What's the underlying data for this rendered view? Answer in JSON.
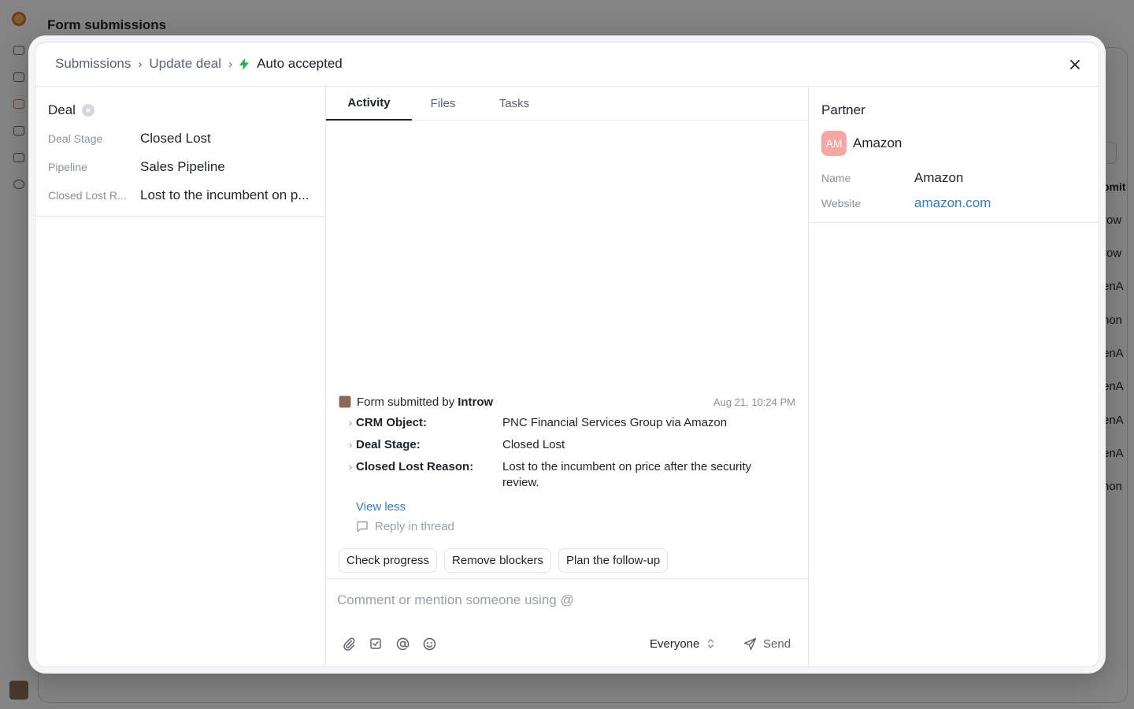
{
  "background": {
    "page_title": "Form submissions",
    "partial_column_header": "bmit",
    "partial_rows": [
      "row",
      "row",
      "enA",
      "hon",
      "enA",
      "enA",
      "enA",
      "enA",
      "hon"
    ]
  },
  "modal": {
    "breadcrumb": [
      "Submissions",
      "Update deal"
    ],
    "status": "Auto accepted",
    "status_color": "#22b24c"
  },
  "deal": {
    "title": "Deal",
    "properties": [
      {
        "label": "Deal Stage",
        "value": "Closed Lost"
      },
      {
        "label": "Pipeline",
        "value": "Sales Pipeline"
      },
      {
        "label": "Closed Lost R...",
        "value": "Lost to the incumbent on p..."
      }
    ]
  },
  "tabs": [
    {
      "label": "Activity",
      "active": true
    },
    {
      "label": "Files",
      "active": false
    },
    {
      "label": "Tasks",
      "active": false
    }
  ],
  "activity": {
    "prefix": "Form submitted by",
    "author": "Introw",
    "timestamp": "Aug 21, 10:24 PM",
    "rows": [
      {
        "key": "CRM Object:",
        "value": "PNC Financial Services Group via Amazon"
      },
      {
        "key": "Deal Stage:",
        "value": "Closed Lost"
      },
      {
        "key": "Closed Lost Reason:",
        "value": "Lost to the incumbent on price after the security review."
      }
    ],
    "view_less": "View less",
    "reply": "Reply in thread"
  },
  "suggestions": [
    "Check progress",
    "Remove blockers",
    "Plan the follow-up"
  ],
  "composer": {
    "placeholder": "Comment or mention someone using @",
    "audience": "Everyone",
    "send": "Send",
    "tools": [
      "paperclip-icon",
      "checkbox-icon",
      "at-icon",
      "emoji-icon"
    ]
  },
  "partner": {
    "title": "Partner",
    "initials": "AM",
    "name": "Amazon",
    "badge_color": "#f6a7a1",
    "properties": [
      {
        "label": "Name",
        "value": "Amazon"
      },
      {
        "label": "Website",
        "value": "amazon.com"
      }
    ]
  }
}
